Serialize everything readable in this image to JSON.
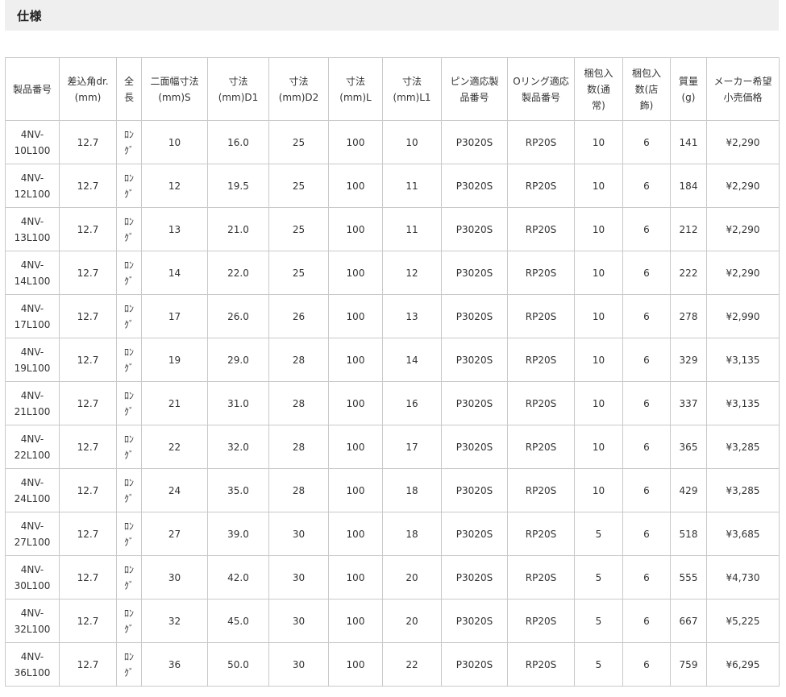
{
  "section": {
    "title": "仕様"
  },
  "table": {
    "headers": [
      "製品番号",
      "差込角dr.\n(mm)",
      "全\n長",
      "二面幅寸法\n(mm)S",
      "寸法\n(mm)D1",
      "寸法\n(mm)D2",
      "寸法\n(mm)L",
      "寸法\n(mm)L1",
      "ピン適応製\n品番号",
      "Oリング適応\n製品番号",
      "梱包入\n数(通\n常)",
      "梱包入\n数(店\n飾)",
      "質量\n(g)",
      "メーカー希望\n小売価格"
    ],
    "rows": [
      {
        "part": "4NV-\n10L100",
        "drive": "12.7",
        "length": "ﾛﾝ\nｸﾞ",
        "s": "10",
        "d1": "16.0",
        "d2": "25",
        "l": "100",
        "l1": "10",
        "pin": "P3020S",
        "oring": "RP20S",
        "pack_normal": "10",
        "pack_store": "6",
        "mass": "141",
        "price": "¥2,290"
      },
      {
        "part": "4NV-\n12L100",
        "drive": "12.7",
        "length": "ﾛﾝ\nｸﾞ",
        "s": "12",
        "d1": "19.5",
        "d2": "25",
        "l": "100",
        "l1": "11",
        "pin": "P3020S",
        "oring": "RP20S",
        "pack_normal": "10",
        "pack_store": "6",
        "mass": "184",
        "price": "¥2,290"
      },
      {
        "part": "4NV-\n13L100",
        "drive": "12.7",
        "length": "ﾛﾝ\nｸﾞ",
        "s": "13",
        "d1": "21.0",
        "d2": "25",
        "l": "100",
        "l1": "11",
        "pin": "P3020S",
        "oring": "RP20S",
        "pack_normal": "10",
        "pack_store": "6",
        "mass": "212",
        "price": "¥2,290"
      },
      {
        "part": "4NV-\n14L100",
        "drive": "12.7",
        "length": "ﾛﾝ\nｸﾞ",
        "s": "14",
        "d1": "22.0",
        "d2": "25",
        "l": "100",
        "l1": "12",
        "pin": "P3020S",
        "oring": "RP20S",
        "pack_normal": "10",
        "pack_store": "6",
        "mass": "222",
        "price": "¥2,290"
      },
      {
        "part": "4NV-\n17L100",
        "drive": "12.7",
        "length": "ﾛﾝ\nｸﾞ",
        "s": "17",
        "d1": "26.0",
        "d2": "26",
        "l": "100",
        "l1": "13",
        "pin": "P3020S",
        "oring": "RP20S",
        "pack_normal": "10",
        "pack_store": "6",
        "mass": "278",
        "price": "¥2,990"
      },
      {
        "part": "4NV-\n19L100",
        "drive": "12.7",
        "length": "ﾛﾝ\nｸﾞ",
        "s": "19",
        "d1": "29.0",
        "d2": "28",
        "l": "100",
        "l1": "14",
        "pin": "P3020S",
        "oring": "RP20S",
        "pack_normal": "10",
        "pack_store": "6",
        "mass": "329",
        "price": "¥3,135"
      },
      {
        "part": "4NV-\n21L100",
        "drive": "12.7",
        "length": "ﾛﾝ\nｸﾞ",
        "s": "21",
        "d1": "31.0",
        "d2": "28",
        "l": "100",
        "l1": "16",
        "pin": "P3020S",
        "oring": "RP20S",
        "pack_normal": "10",
        "pack_store": "6",
        "mass": "337",
        "price": "¥3,135"
      },
      {
        "part": "4NV-\n22L100",
        "drive": "12.7",
        "length": "ﾛﾝ\nｸﾞ",
        "s": "22",
        "d1": "32.0",
        "d2": "28",
        "l": "100",
        "l1": "17",
        "pin": "P3020S",
        "oring": "RP20S",
        "pack_normal": "10",
        "pack_store": "6",
        "mass": "365",
        "price": "¥3,285"
      },
      {
        "part": "4NV-\n24L100",
        "drive": "12.7",
        "length": "ﾛﾝ\nｸﾞ",
        "s": "24",
        "d1": "35.0",
        "d2": "28",
        "l": "100",
        "l1": "18",
        "pin": "P3020S",
        "oring": "RP20S",
        "pack_normal": "10",
        "pack_store": "6",
        "mass": "429",
        "price": "¥3,285"
      },
      {
        "part": "4NV-\n27L100",
        "drive": "12.7",
        "length": "ﾛﾝ\nｸﾞ",
        "s": "27",
        "d1": "39.0",
        "d2": "30",
        "l": "100",
        "l1": "18",
        "pin": "P3020S",
        "oring": "RP20S",
        "pack_normal": "5",
        "pack_store": "6",
        "mass": "518",
        "price": "¥3,685"
      },
      {
        "part": "4NV-\n30L100",
        "drive": "12.7",
        "length": "ﾛﾝ\nｸﾞ",
        "s": "30",
        "d1": "42.0",
        "d2": "30",
        "l": "100",
        "l1": "20",
        "pin": "P3020S",
        "oring": "RP20S",
        "pack_normal": "5",
        "pack_store": "6",
        "mass": "555",
        "price": "¥4,730"
      },
      {
        "part": "4NV-\n32L100",
        "drive": "12.7",
        "length": "ﾛﾝ\nｸﾞ",
        "s": "32",
        "d1": "45.0",
        "d2": "30",
        "l": "100",
        "l1": "20",
        "pin": "P3020S",
        "oring": "RP20S",
        "pack_normal": "5",
        "pack_store": "6",
        "mass": "667",
        "price": "¥5,225"
      },
      {
        "part": "4NV-\n36L100",
        "drive": "12.7",
        "length": "ﾛﾝ\nｸﾞ",
        "s": "36",
        "d1": "50.0",
        "d2": "30",
        "l": "100",
        "l1": "22",
        "pin": "P3020S",
        "oring": "RP20S",
        "pack_normal": "5",
        "pack_store": "6",
        "mass": "759",
        "price": "¥6,295"
      }
    ]
  }
}
